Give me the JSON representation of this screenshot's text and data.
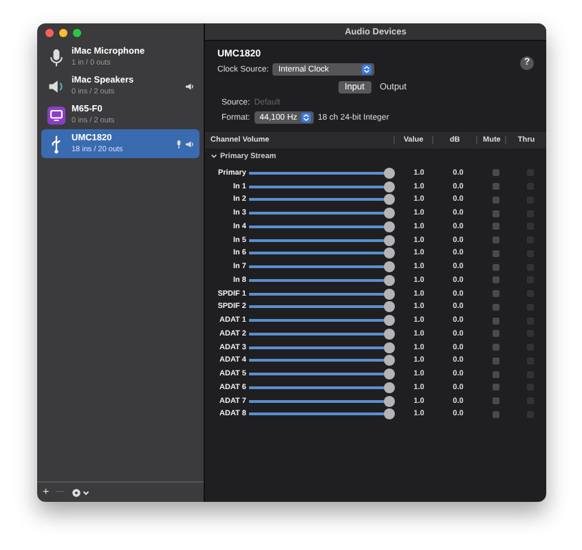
{
  "window": {
    "title": "Audio Devices"
  },
  "devices": [
    {
      "name": "iMac Microphone",
      "io": "1 in / 0 outs",
      "kind": "microphone",
      "selected": false,
      "default_input": false,
      "default_output": false
    },
    {
      "name": "iMac Speakers",
      "io": "0 ins / 2 outs",
      "kind": "speaker",
      "selected": false,
      "default_input": false,
      "default_output": true
    },
    {
      "name": "M65-F0",
      "io": "0 ins / 2 outs",
      "kind": "display",
      "selected": false,
      "default_input": false,
      "default_output": false
    },
    {
      "name": "UMC1820",
      "io": "18 ins / 20 outs",
      "kind": "usb",
      "selected": true,
      "default_input": true,
      "default_output": true
    }
  ],
  "sidebar_toolbar": {
    "add": "+",
    "remove": "—"
  },
  "detail": {
    "device_name": "UMC1820",
    "clock_label": "Clock Source:",
    "clock_value": "Internal Clock",
    "help": "?",
    "tabs": [
      {
        "label": "Input",
        "selected": true
      },
      {
        "label": "Output",
        "selected": false
      }
    ],
    "source_label": "Source:",
    "source_value": "Default",
    "format_label": "Format:",
    "format_value": "44,100 Hz",
    "format_desc": "18 ch 24-bit Integer"
  },
  "table": {
    "columns": [
      "Channel Volume",
      "Value",
      "dB",
      "Mute",
      "Thru"
    ],
    "group": "Primary Stream",
    "rows": [
      {
        "name": "Primary",
        "level": 1,
        "value": "1.0",
        "db": "0.0",
        "mute": false,
        "thru": false
      },
      {
        "name": "In 1",
        "level": 1,
        "value": "1.0",
        "db": "0.0",
        "mute": false,
        "thru": false
      },
      {
        "name": "In 2",
        "level": 1,
        "value": "1.0",
        "db": "0.0",
        "mute": false,
        "thru": false
      },
      {
        "name": "In 3",
        "level": 1,
        "value": "1.0",
        "db": "0.0",
        "mute": false,
        "thru": false
      },
      {
        "name": "In 4",
        "level": 1,
        "value": "1.0",
        "db": "0.0",
        "mute": false,
        "thru": false
      },
      {
        "name": "In 5",
        "level": 1,
        "value": "1.0",
        "db": "0.0",
        "mute": false,
        "thru": false
      },
      {
        "name": "In 6",
        "level": 1,
        "value": "1.0",
        "db": "0.0",
        "mute": false,
        "thru": false
      },
      {
        "name": "In 7",
        "level": 1,
        "value": "1.0",
        "db": "0.0",
        "mute": false,
        "thru": false
      },
      {
        "name": "In 8",
        "level": 1,
        "value": "1.0",
        "db": "0.0",
        "mute": false,
        "thru": false
      },
      {
        "name": "SPDIF 1",
        "level": 1,
        "value": "1.0",
        "db": "0.0",
        "mute": false,
        "thru": false
      },
      {
        "name": "SPDIF 2",
        "level": 1,
        "value": "1.0",
        "db": "0.0",
        "mute": false,
        "thru": false
      },
      {
        "name": "ADAT 1",
        "level": 1,
        "value": "1.0",
        "db": "0.0",
        "mute": false,
        "thru": false
      },
      {
        "name": "ADAT 2",
        "level": 1,
        "value": "1.0",
        "db": "0.0",
        "mute": false,
        "thru": false
      },
      {
        "name": "ADAT 3",
        "level": 1,
        "value": "1.0",
        "db": "0.0",
        "mute": false,
        "thru": false
      },
      {
        "name": "ADAT 4",
        "level": 1,
        "value": "1.0",
        "db": "0.0",
        "mute": false,
        "thru": false
      },
      {
        "name": "ADAT 5",
        "level": 1,
        "value": "1.0",
        "db": "0.0",
        "mute": false,
        "thru": false
      },
      {
        "name": "ADAT 6",
        "level": 1,
        "value": "1.0",
        "db": "0.0",
        "mute": false,
        "thru": false
      },
      {
        "name": "ADAT 7",
        "level": 1,
        "value": "1.0",
        "db": "0.0",
        "mute": false,
        "thru": false
      },
      {
        "name": "ADAT 8",
        "level": 1,
        "value": "1.0",
        "db": "0.0",
        "mute": false,
        "thru": false
      }
    ]
  }
}
